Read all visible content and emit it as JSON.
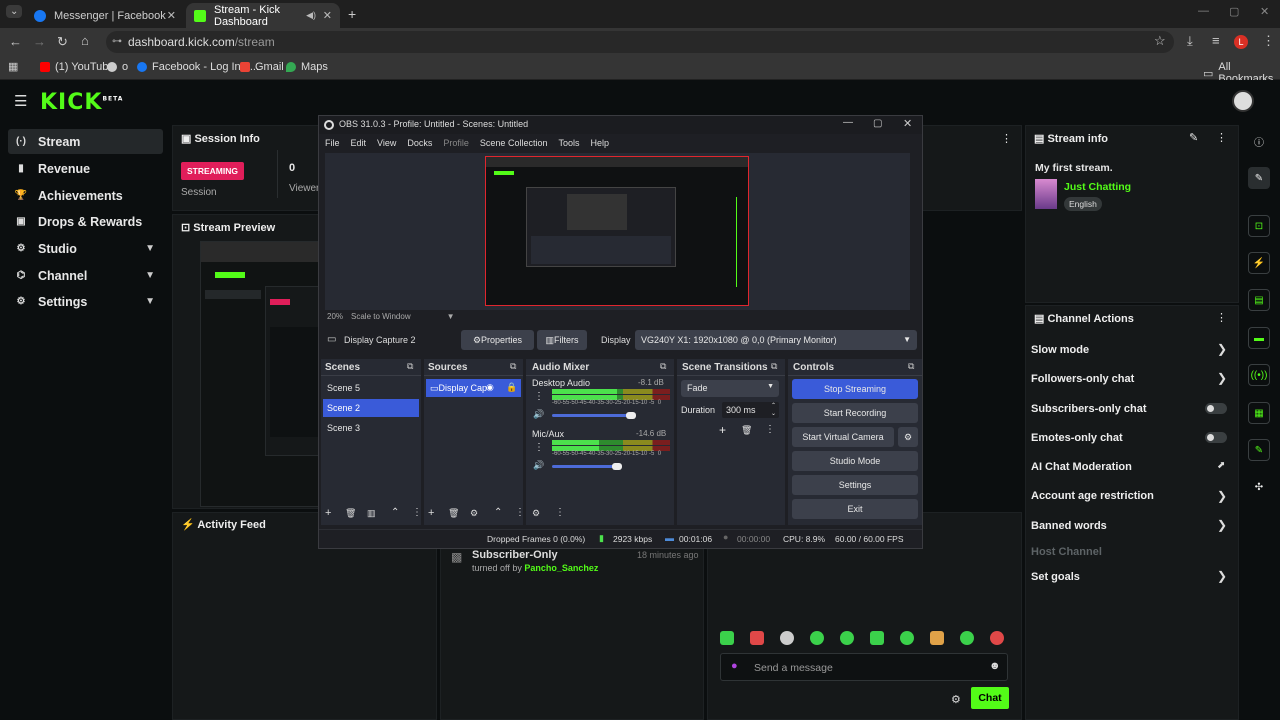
{
  "browser": {
    "tabs": [
      {
        "title": "Messenger | Facebook",
        "color": "#1877f2"
      },
      {
        "title": "Stream - Kick Dashboard",
        "color": "#53fc18"
      }
    ],
    "url_host": "dashboard.kick.com",
    "url_path": "/stream",
    "profile_initial": "L",
    "bookmarks": [
      {
        "label": "(1) YouTube",
        "color": "#ff0000"
      },
      {
        "label": "o",
        "color": "#cccccc"
      },
      {
        "label": "Facebook - Log In o...",
        "color": "#1877f2"
      },
      {
        "label": "Gmail",
        "color": "#ea4335"
      },
      {
        "label": "Maps",
        "color": "#34a853"
      }
    ],
    "all_bookmarks": "All Bookmarks"
  },
  "kick": {
    "logo": "KICK",
    "logo_badge": "BETA",
    "nav": [
      {
        "label": "Stream",
        "icon": "(·)"
      },
      {
        "label": "Revenue",
        "icon": "▮"
      },
      {
        "label": "Achievements",
        "icon": "🏆"
      },
      {
        "label": "Drops & Rewards",
        "icon": "▣"
      },
      {
        "label": "Studio",
        "icon": "⚙"
      },
      {
        "label": "Channel",
        "icon": "⌬"
      },
      {
        "label": "Settings",
        "icon": "⚙"
      }
    ],
    "session_info": {
      "title": "Session Info",
      "badge": "STREAMING",
      "session_label": "Session",
      "viewers_value": "0",
      "viewers_label": "Viewers"
    },
    "stream_preview": {
      "title": "Stream Preview"
    },
    "activity_feed": {
      "title": "Activity Feed",
      "item_title": "Subscriber-Only",
      "item_text": "turned off by",
      "item_user": "Pancho_Sanchez",
      "item_time": "18 minutes ago"
    },
    "chat": {
      "placeholder": "Send a message",
      "send_label": "Chat"
    },
    "stream_info": {
      "title": "Stream info",
      "stream_title": "My first stream.",
      "category": "Just Chatting",
      "language": "English"
    },
    "channel_actions": {
      "title": "Channel Actions",
      "items": [
        {
          "label": "Slow mode",
          "control": "arrow"
        },
        {
          "label": "Followers-only chat",
          "control": "arrow"
        },
        {
          "label": "Subscribers-only chat",
          "control": "toggle"
        },
        {
          "label": "Emotes-only chat",
          "control": "toggle"
        },
        {
          "label": "AI Chat Moderation",
          "control": "external"
        },
        {
          "label": "Account age restriction",
          "control": "arrow"
        },
        {
          "label": "Banned words",
          "control": "arrow"
        },
        {
          "label": "Host Channel",
          "control": "none"
        },
        {
          "label": "Set goals",
          "control": "arrow"
        }
      ]
    }
  },
  "obs": {
    "title": "OBS 31.0.3 - Profile: Untitled - Scenes: Untitled",
    "menu": [
      "File",
      "Edit",
      "View",
      "Docks",
      "Profile",
      "Scene Collection",
      "Tools",
      "Help"
    ],
    "zoom": "20%",
    "scale_mode": "Scale to Window",
    "source_name": "Display Capture 2",
    "properties_label": "Properties",
    "filters_label": "Filters",
    "display_label": "Display",
    "display_value": "VG240Y X1: 1920x1080 @ 0,0 (Primary Monitor)",
    "docks": {
      "scenes": "Scenes",
      "sources": "Sources",
      "mixer": "Audio Mixer",
      "transitions": "Scene Transitions",
      "controls": "Controls"
    },
    "scenes": [
      "Scene 5",
      "Scene 2",
      "Scene 3"
    ],
    "selected_scene": "Scene 2",
    "sources": [
      "Display Cap"
    ],
    "mixer": [
      {
        "name": "Desktop Audio",
        "db": "-8.1 dB",
        "level": 0.55
      },
      {
        "name": "Mic/Aux",
        "db": "-14.6 dB",
        "level": 0.4
      }
    ],
    "meter_scale": "-60-55-50-45-40-35-30-25-20-15-10 -5  0",
    "transition": "Fade",
    "duration_label": "Duration",
    "duration_value": "300 ms",
    "controls": [
      "Stop Streaming",
      "Start Recording",
      "Start Virtual Camera",
      "Studio Mode",
      "Settings",
      "Exit"
    ],
    "status": {
      "dropped": "Dropped Frames 0 (0.0%)",
      "bitrate": "2923 kbps",
      "stream_time": "00:01:06",
      "rec_time": "00:00:00",
      "cpu": "CPU: 8.9%",
      "fps": "60.00 / 60.00 FPS"
    }
  }
}
